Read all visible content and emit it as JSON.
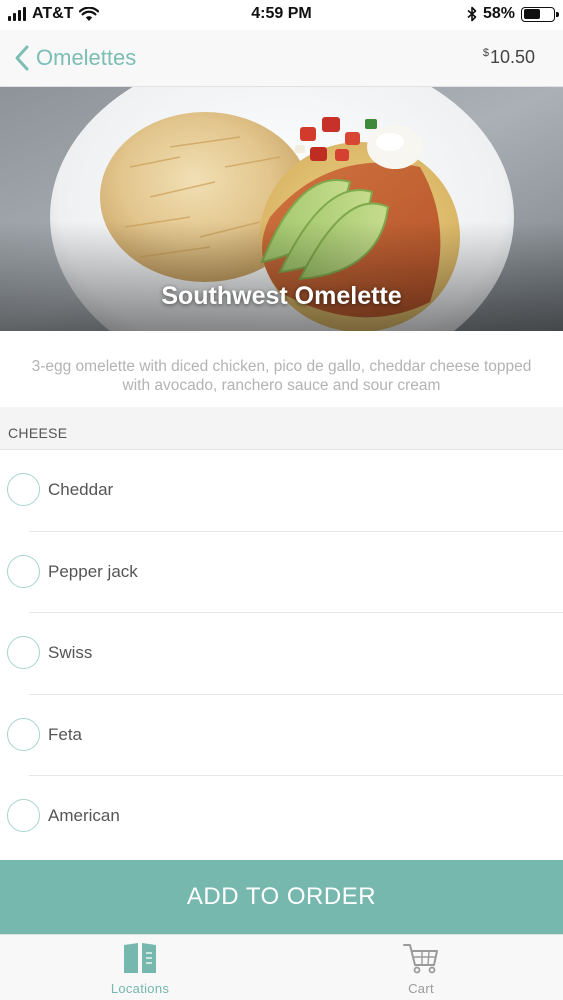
{
  "status_bar": {
    "carrier": "AT&T",
    "time": "4:59 PM",
    "battery_text": "58%",
    "battery_level": 0.58,
    "icons": [
      "cellular-signal-icon",
      "wifi-icon",
      "bluetooth-icon",
      "battery-icon"
    ]
  },
  "nav": {
    "back_label": "Omelettes",
    "price_symbol": "$",
    "price_value": "10.50"
  },
  "item": {
    "title": "Southwest Omelette",
    "description": "3-egg omelette with diced chicken, pico de gallo, cheddar cheese topped with avocado, ranchero sauce and sour cream"
  },
  "section": {
    "title": "CHEESE",
    "options": [
      {
        "label": "Cheddar",
        "selected": false
      },
      {
        "label": "Pepper jack",
        "selected": false
      },
      {
        "label": "Swiss",
        "selected": false
      },
      {
        "label": "Feta",
        "selected": false
      },
      {
        "label": "American",
        "selected": false
      }
    ]
  },
  "actions": {
    "add_to_order_label": "ADD TO ORDER"
  },
  "tab_bar": {
    "tabs": [
      {
        "label": "Locations",
        "icon": "map-book-icon",
        "active": true
      },
      {
        "label": "Cart",
        "icon": "cart-icon",
        "active": false
      }
    ]
  },
  "colors": {
    "accent": "#76b7ae",
    "nav_text": "#7cbdb4",
    "radio_border": "#a8d4ce",
    "inactive_tab": "#9a9a9a"
  }
}
